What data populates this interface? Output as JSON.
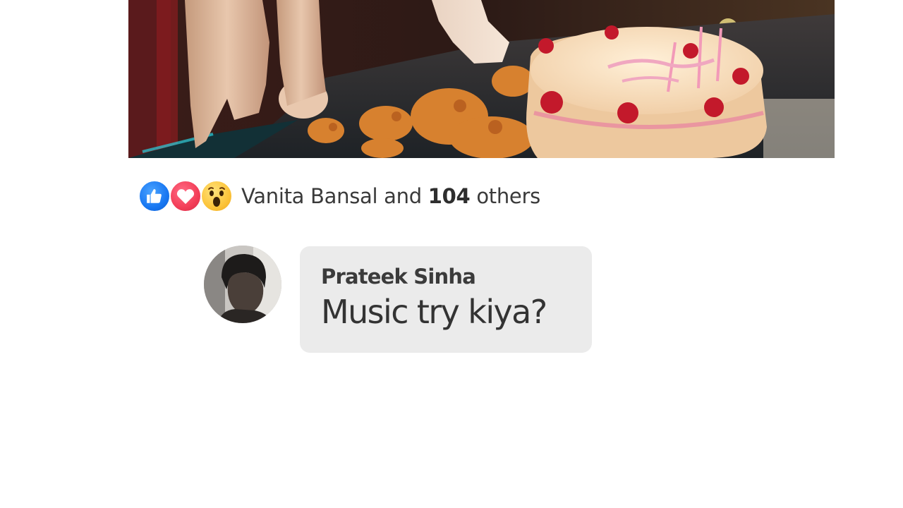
{
  "post": {
    "photo_icon": "dog-birthday-cake-photo"
  },
  "reactions": {
    "icons": [
      "like-icon",
      "love-icon",
      "wow-icon"
    ],
    "first_name": "Vanita Bansal",
    "and_label": "and",
    "count": "104",
    "others_label": "others",
    "colors": {
      "like": "#1877f2",
      "love": "#f33e58",
      "wow": "#fcc43a"
    }
  },
  "comment": {
    "author": "Prateek Sinha",
    "text": "Music try kiya?",
    "bubble_color": "#ebebeb"
  }
}
